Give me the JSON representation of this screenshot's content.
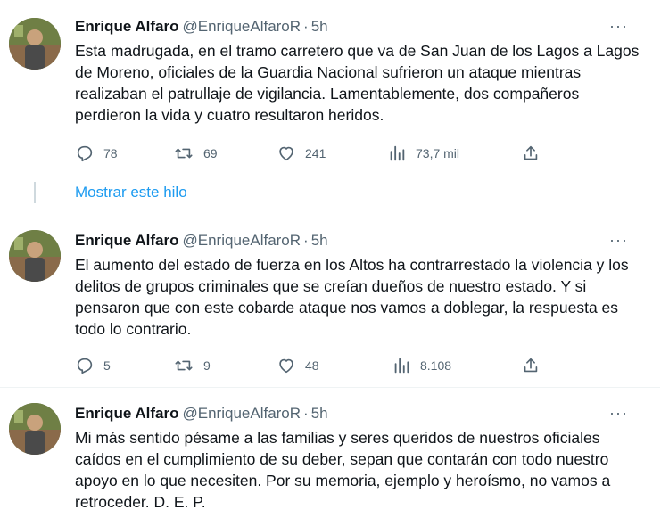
{
  "colors": {
    "text": "#0f1419",
    "secondary": "#536471",
    "link": "#1d9bf0",
    "divider": "#eff3f4"
  },
  "tweets": [
    {
      "name": "Enrique Alfaro",
      "handle": "@EnriqueAlfaroR",
      "separator": "·",
      "time": "5h",
      "more": "···",
      "text": "Esta madrugada, en el tramo carretero que va de San Juan de los Lagos a Lagos de Moreno, oficiales de la Guardia Nacional sufrieron un ataque mientras realizaban el patrullaje de vigilancia. Lamentablemente, dos compañeros perdieron la vida y cuatro resultaron heridos.",
      "replies": "78",
      "retweets": "69",
      "likes": "241",
      "views": "73,7 mil"
    },
    {
      "name": "Enrique Alfaro",
      "handle": "@EnriqueAlfaroR",
      "separator": "·",
      "time": "5h",
      "more": "···",
      "text": "El aumento del estado de fuerza en los Altos ha contrarrestado la violencia y los delitos de grupos criminales que se creían dueños de nuestro estado. Y si pensaron que con este cobarde ataque nos vamos a doblegar, la respuesta es todo lo contrario.",
      "replies": "5",
      "retweets": "9",
      "likes": "48",
      "views": "8.108"
    },
    {
      "name": "Enrique Alfaro",
      "handle": "@EnriqueAlfaroR",
      "separator": "·",
      "time": "5h",
      "more": "···",
      "text": "Mi más sentido pésame a las familias y seres queridos de nuestros oficiales caídos en el cumplimiento de su deber, sepan que contarán con todo nuestro apoyo en lo que necesiten. Por su memoria, ejemplo y heroísmo, no vamos a retroceder. D. E. P."
    }
  ],
  "show_thread": "Mostrar este hilo",
  "icons": {
    "reply": "reply-icon",
    "retweet": "retweet-icon",
    "like": "heart-icon",
    "views": "views-icon",
    "share": "share-icon"
  }
}
